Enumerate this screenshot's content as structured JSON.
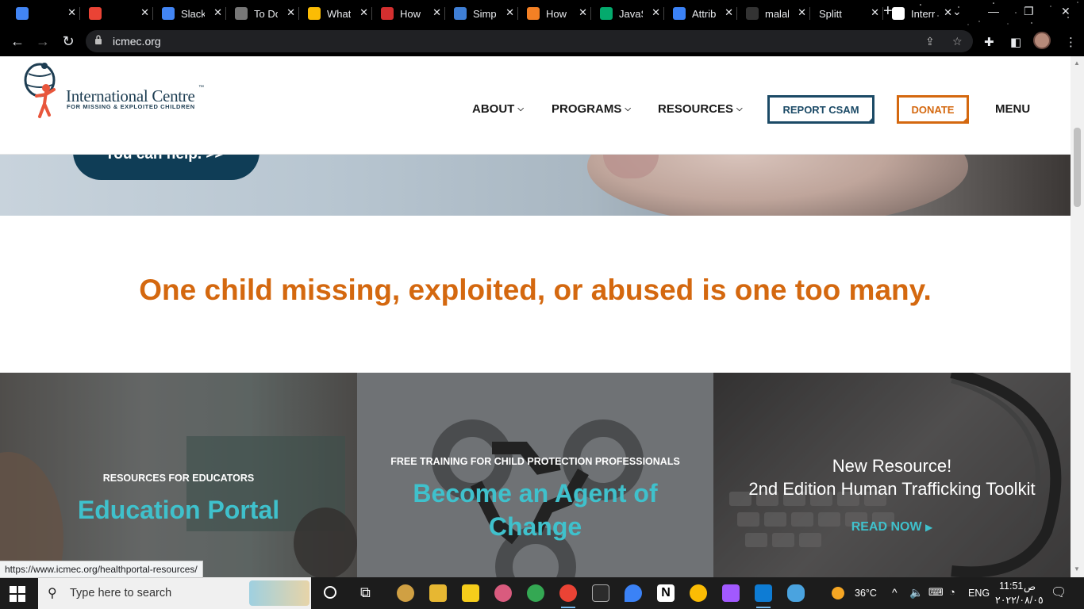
{
  "browser": {
    "tabs": [
      {
        "title": "",
        "favicon": "calendar-icon",
        "color": "#4285f4"
      },
      {
        "title": "",
        "favicon": "gmail-icon",
        "color": "#ea4335"
      },
      {
        "title": "Slack",
        "favicon": "google-icon",
        "color": "#4285f4"
      },
      {
        "title": "To Do",
        "favicon": "globe-icon",
        "color": "#777777"
      },
      {
        "title": "What",
        "favicon": "chrome-icon",
        "color": "#fbbc04"
      },
      {
        "title": "How",
        "favicon": "hub-icon",
        "color": "#d32f2f"
      },
      {
        "title": "Simp",
        "favicon": "codesandbox-icon",
        "color": "#3f7fd6"
      },
      {
        "title": "How",
        "favicon": "stackoverflow-icon",
        "color": "#f48024"
      },
      {
        "title": "JavaS",
        "favicon": "w3-icon",
        "color": "#04aa6d"
      },
      {
        "title": "Attrib",
        "favicon": "moon-icon",
        "color": "#3b82f6"
      },
      {
        "title": "malal",
        "favicon": "github-icon",
        "color": "#333333"
      },
      {
        "title": "Splitt",
        "favicon": "",
        "color": "#000000"
      },
      {
        "title": "Interr",
        "favicon": "icmec-icon",
        "color": "#ffffff"
      }
    ],
    "url": "icmec.org",
    "status_url": "https://www.icmec.org/healthportal-resources/"
  },
  "site": {
    "logo_name": "International Centre",
    "logo_tm": "™",
    "logo_sub": "FOR MISSING & EXPLOITED CHILDREN",
    "nav": {
      "about": "ABOUT",
      "programs": "PROGRAMS",
      "resources": "RESOURCES",
      "report": "REPORT CSAM",
      "donate": "DONATE",
      "menu": "MENU"
    },
    "hero_button": "You can help. >>",
    "tagline": "One child missing, exploited, or abused is one too many.",
    "panels": {
      "education": {
        "kicker": "RESOURCES FOR EDUCATORS",
        "title": "Education Portal"
      },
      "agent": {
        "kicker": "FREE TRAINING FOR CHILD PROTECTION PROFESSIONALS",
        "title_line1": "Become an Agent of",
        "title_line2": "Change"
      },
      "toolkit": {
        "line1": "New Resource!",
        "line2": "2nd Edition Human Trafficking Toolkit",
        "link": "READ NOW"
      }
    }
  },
  "taskbar": {
    "search_placeholder": "Type here to search",
    "weather": "36°C",
    "language": "ENG",
    "time": "11:51",
    "ampm": "ص",
    "date": "٢٠٢٢/٠٨/٠٥"
  },
  "colors": {
    "accent_orange": "#d4680f",
    "brand_navy": "#1b4a66",
    "teal": "#3fc1cc"
  }
}
